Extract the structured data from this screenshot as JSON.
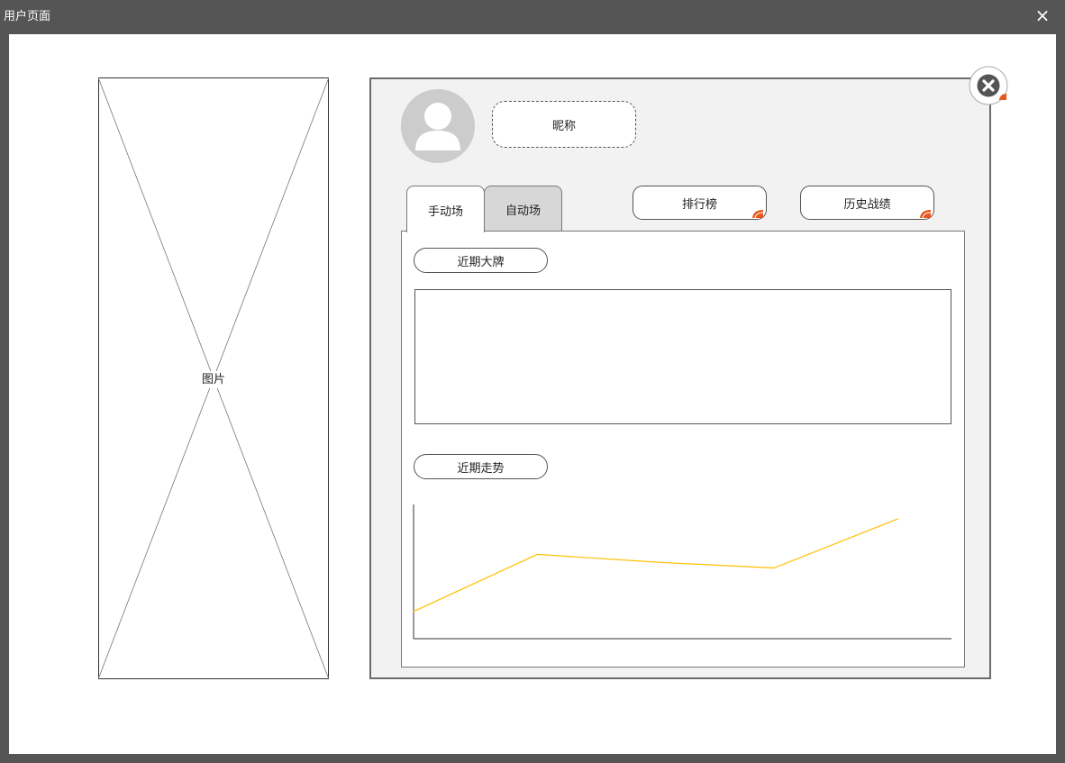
{
  "window": {
    "title": "用户页面",
    "close_symbol": "×"
  },
  "image_placeholder": {
    "label": "图片"
  },
  "profile": {
    "nickname": "昵称"
  },
  "tabs": [
    {
      "label": "手动场",
      "active": true
    },
    {
      "label": "自动场",
      "active": false
    }
  ],
  "buttons": {
    "leaderboard": "排行榜",
    "history": "历史战绩"
  },
  "sections": {
    "recent_cards": "近期大牌",
    "recent_trend": "近期走势"
  },
  "colors": {
    "trend_line": "#ffc000",
    "corner_marker": "#e8581c",
    "close_badge": "#555555"
  },
  "chart_data": {
    "type": "line",
    "x": [
      0,
      1,
      2,
      3,
      4
    ],
    "series": [
      {
        "values": [
          20,
          62,
          56,
          52,
          88
        ]
      }
    ],
    "title": "",
    "xlabel": "",
    "ylabel": "",
    "ylim": [
      0,
      100
    ],
    "grid": false
  }
}
